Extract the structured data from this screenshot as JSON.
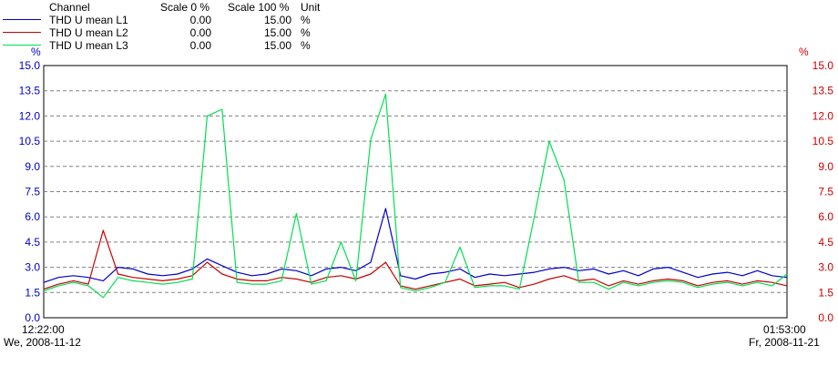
{
  "legend": {
    "header": {
      "channel": "Channel",
      "scale0": "Scale 0 %",
      "scale100": "Scale 100 %",
      "unit": "Unit"
    },
    "rows": [
      {
        "name": "THD U mean L1",
        "scale0": "0.00",
        "scale100": "15.00",
        "unit": "%",
        "color": "#0000c8"
      },
      {
        "name": "THD U mean L2",
        "scale0": "0.00",
        "scale100": "15.00",
        "unit": "%",
        "color": "#c80000"
      },
      {
        "name": "THD U mean L3",
        "scale0": "0.00",
        "scale100": "15.00",
        "unit": "%",
        "color": "#00e050"
      }
    ]
  },
  "axes": {
    "left_unit": "%",
    "right_unit": "%",
    "left_color": "#0000c8",
    "right_color": "#c80000"
  },
  "time": {
    "start_time": "12:22:00",
    "start_date": "We, 2008-11-12",
    "end_time": "01:53:00",
    "end_date": "Fr, 2008-11-21"
  },
  "chart_data": {
    "type": "line",
    "ylim": [
      0,
      15
    ],
    "yticks": [
      "0.0",
      "1.5",
      "3.0",
      "4.5",
      "6.0",
      "7.5",
      "9.0",
      "10.5",
      "12.0",
      "13.5",
      "15.0"
    ],
    "grid": true,
    "x": [
      0,
      2,
      4,
      6,
      8,
      10,
      12,
      14,
      16,
      18,
      20,
      22,
      24,
      26,
      28,
      30,
      32,
      34,
      36,
      38,
      40,
      42,
      44,
      46,
      48,
      50,
      52,
      54,
      56,
      58,
      60,
      62,
      64,
      66,
      68,
      70,
      72,
      74,
      76,
      78,
      80,
      82,
      84,
      86,
      88,
      90,
      92,
      94,
      96,
      98,
      100
    ],
    "series": [
      {
        "name": "THD U mean L1",
        "color": "#0000c8",
        "values": [
          2.1,
          2.4,
          2.5,
          2.4,
          2.2,
          3.0,
          2.9,
          2.6,
          2.5,
          2.6,
          2.9,
          3.5,
          3.1,
          2.7,
          2.5,
          2.6,
          2.9,
          2.8,
          2.5,
          2.9,
          3.0,
          2.8,
          3.3,
          6.5,
          2.5,
          2.3,
          2.6,
          2.7,
          2.9,
          2.4,
          2.6,
          2.5,
          2.6,
          2.7,
          2.9,
          3.0,
          2.8,
          2.9,
          2.6,
          2.8,
          2.5,
          2.9,
          3.0,
          2.7,
          2.4,
          2.6,
          2.7,
          2.5,
          2.8,
          2.5,
          2.4
        ]
      },
      {
        "name": "THD U mean L2",
        "color": "#c80000",
        "values": [
          1.7,
          2.0,
          2.2,
          2.0,
          5.2,
          2.6,
          2.4,
          2.3,
          2.2,
          2.3,
          2.5,
          3.3,
          2.6,
          2.3,
          2.2,
          2.2,
          2.4,
          2.3,
          2.1,
          2.4,
          2.5,
          2.3,
          2.6,
          3.3,
          1.9,
          1.7,
          1.9,
          2.1,
          2.3,
          1.9,
          2.0,
          2.1,
          1.8,
          2.0,
          2.3,
          2.5,
          2.2,
          2.3,
          1.9,
          2.2,
          2.0,
          2.2,
          2.3,
          2.2,
          1.9,
          2.1,
          2.2,
          2.0,
          2.2,
          2.1,
          1.9
        ]
      },
      {
        "name": "THD U mean L3",
        "color": "#00e050",
        "values": [
          1.6,
          1.9,
          2.1,
          1.9,
          1.2,
          2.4,
          2.2,
          2.1,
          2.0,
          2.1,
          2.3,
          12.0,
          12.4,
          2.1,
          2.0,
          2.0,
          2.2,
          6.2,
          2.0,
          2.2,
          4.5,
          2.2,
          10.6,
          13.3,
          1.8,
          1.6,
          1.8,
          2.1,
          4.2,
          1.8,
          1.9,
          1.9,
          1.7,
          6.0,
          10.5,
          8.2,
          2.1,
          2.1,
          1.7,
          2.1,
          1.9,
          2.1,
          2.2,
          2.1,
          1.8,
          2.0,
          2.1,
          1.9,
          2.1,
          1.9,
          2.6
        ]
      }
    ]
  }
}
